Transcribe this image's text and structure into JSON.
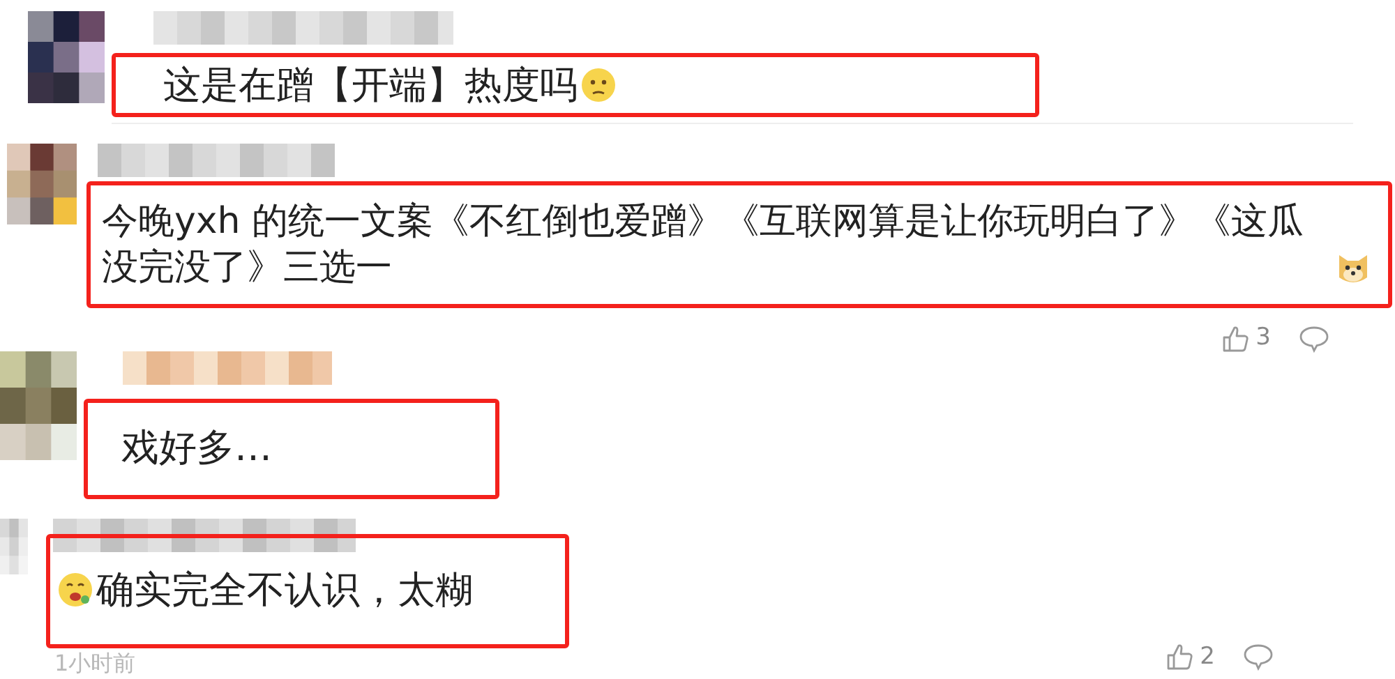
{
  "comments": [
    {
      "text": "这是在蹭【开端】热度吗",
      "emoji_before": false,
      "emoji_after": true
    },
    {
      "text": "今晚yxh 的统一文案《不红倒也爱蹭》《互联网算是让你玩明白了》《这瓜没完没了》三选一",
      "emoji_before": false,
      "emoji_after": true,
      "likes": "3"
    },
    {
      "text": "戏好多…",
      "emoji_before": false,
      "emoji_after": false
    },
    {
      "text": "确实完全不认识，太糊",
      "emoji_before": true,
      "emoji_after": false,
      "time": "1小时前",
      "likes": "2"
    }
  ]
}
